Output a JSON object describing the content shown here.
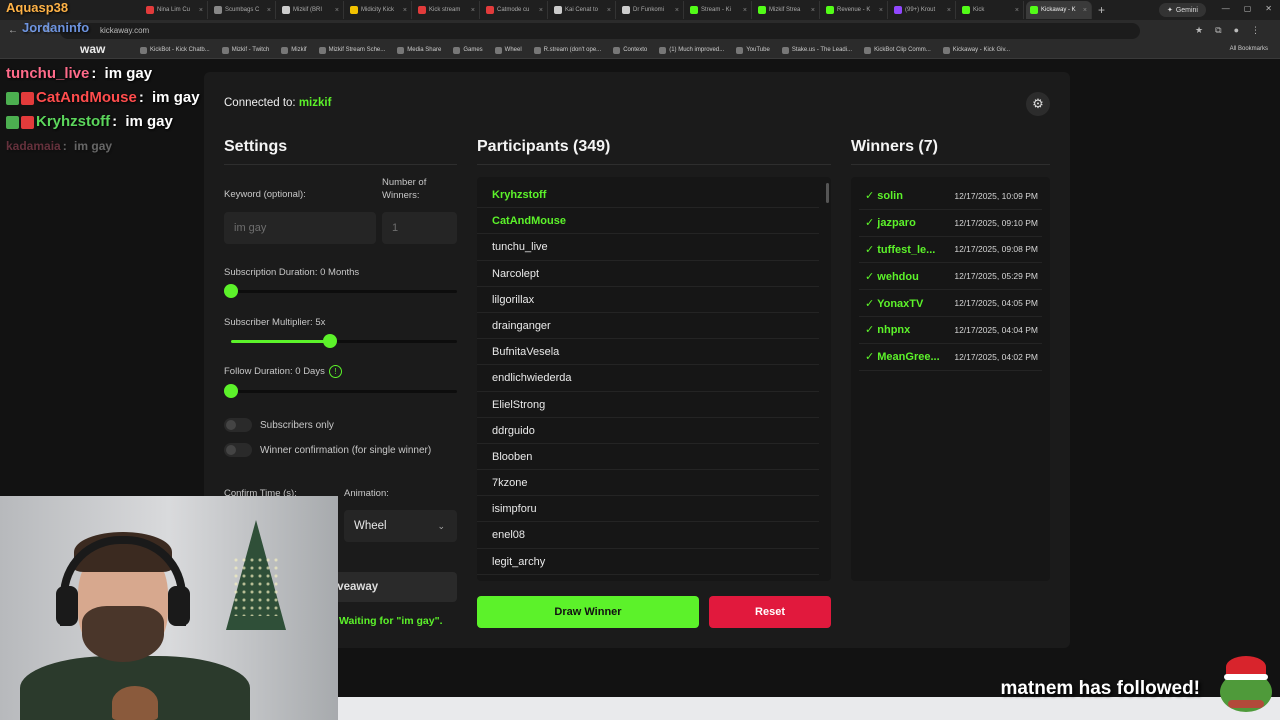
{
  "browser": {
    "tabs": [
      {
        "label": "Nina Lim Cu",
        "color": "#e23b3b"
      },
      {
        "label": "Scumbags C",
        "color": "#888888"
      },
      {
        "label": "Mizkif (BRI",
        "color": "#cccccc"
      },
      {
        "label": "Midicity Kick",
        "color": "#f2c200"
      },
      {
        "label": "Kick stream",
        "color": "#e23b3b"
      },
      {
        "label": "Catmode cu",
        "color": "#e23b3b"
      },
      {
        "label": "Kai Cenat to",
        "color": "#cccccc"
      },
      {
        "label": "Dr Funkomi",
        "color": "#cccccc"
      },
      {
        "label": "Stream - Ki",
        "color": "#53fc18"
      },
      {
        "label": "Mizkif Strea",
        "color": "#53fc18"
      },
      {
        "label": "Revenue - K",
        "color": "#53fc18"
      },
      {
        "label": "(99+) Krout",
        "color": "#9147ff"
      },
      {
        "label": "Kick",
        "color": "#53fc18"
      },
      {
        "label": "Kickaway - K",
        "color": "#53fc18"
      }
    ],
    "new_tab": "+",
    "gemini_label": "Gemini",
    "url": "kickaway.com",
    "bookmarks": [
      "KickBot - Kick Chatb...",
      "Mizkif - Twitch",
      "Mizkif",
      "Mizkif Stream Sche...",
      "Media Share",
      "Games",
      "Wheel",
      "R.stream (don't ope...",
      "Contexto",
      "(1) Much improved...",
      "YouTube",
      "Stake.us - The Leadi...",
      "KickBot Clip Comm...",
      "Kickaway - Kick Giv..."
    ],
    "all_bookmarks": "All Bookmarks"
  },
  "overlay": {
    "top1": "Aquasp38",
    "top2": "Jordaninfo",
    "top3": "waw",
    "chat": [
      {
        "name": "tunchu_live",
        "msg": "im gay",
        "name_color": "#ff6b8a",
        "badges": []
      },
      {
        "name": "CatAndMouse",
        "msg": "im gay",
        "name_color": "#ff4d4d",
        "badges": [
          "#4caf50",
          "#e23b3b"
        ]
      },
      {
        "name": "Kryhzstoff",
        "msg": "im gay",
        "name_color": "#5cd65c",
        "badges": [
          "#4caf50",
          "#e23b3b"
        ]
      },
      {
        "name": "kadamaia",
        "msg": "im gay",
        "name_color": "#ff6b8a",
        "badges": []
      }
    ],
    "follow_alert": "matnem has followed!"
  },
  "app": {
    "connected_label": "Connected to:",
    "channel": "mizkif",
    "settings": {
      "title": "Settings",
      "keyword_label": "Keyword (optional):",
      "keyword_value": "im gay",
      "winners_label": "Number of Winners:",
      "winners_value": "1",
      "sub_duration_label": "Subscription Duration: 0 Months",
      "sub_duration_value": 0,
      "sub_multiplier_label": "Subscriber Multiplier: 5x",
      "sub_multiplier_value": 0.44,
      "follow_duration_label": "Follow Duration: 0 Days",
      "follow_duration_value": 0,
      "info_glyph": "!",
      "subscribers_only_label": "Subscribers only",
      "subscribers_only": false,
      "winner_confirm_label": "Winner confirmation (for single winner)",
      "winner_confirm": false,
      "confirm_time_label": "Confirm Time (s):",
      "animation_label": "Animation:",
      "animation_value": "Wheel",
      "start_button": "iveaway",
      "status": "Waiting for \"im gay\"."
    },
    "participants": {
      "title": "Participants (349)",
      "items": [
        {
          "name": "Kryhzstoff",
          "winner": true
        },
        {
          "name": "CatAndMouse",
          "winner": true
        },
        {
          "name": "tunchu_live",
          "winner": false
        },
        {
          "name": "Narcolept",
          "winner": false
        },
        {
          "name": "lilgorillax",
          "winner": false
        },
        {
          "name": "drainganger",
          "winner": false
        },
        {
          "name": "BufnitaVesela",
          "winner": false
        },
        {
          "name": "endlichwiederda",
          "winner": false
        },
        {
          "name": "ElielStrong",
          "winner": false
        },
        {
          "name": "ddrguido",
          "winner": false
        },
        {
          "name": "Blooben",
          "winner": false
        },
        {
          "name": "7kzone",
          "winner": false
        },
        {
          "name": "isimpforu",
          "winner": false
        },
        {
          "name": "enel08",
          "winner": false
        },
        {
          "name": "legit_archy",
          "winner": false
        }
      ]
    },
    "winners": {
      "title": "Winners (7)",
      "items": [
        {
          "name": "✓ solin",
          "date": "12/17/2025, 10:09 PM"
        },
        {
          "name": "✓ jazparo",
          "date": "12/17/2025, 09:10 PM"
        },
        {
          "name": "✓ tuffest_le...",
          "date": "12/17/2025, 09:08 PM"
        },
        {
          "name": "✓ wehdou",
          "date": "12/17/2025, 05:29 PM"
        },
        {
          "name": "✓ YonaxTV",
          "date": "12/17/2025, 04:05 PM"
        },
        {
          "name": "✓ nhpnx",
          "date": "12/17/2025, 04:04 PM"
        },
        {
          "name": "✓ MeanGree...",
          "date": "12/17/2025, 04:02 PM"
        }
      ]
    },
    "draw_button": "Draw Winner",
    "reset_button": "Reset"
  },
  "colors": {
    "accent": "#5cf22a",
    "danger": "#e1193d",
    "card": "#1b1b1b"
  }
}
